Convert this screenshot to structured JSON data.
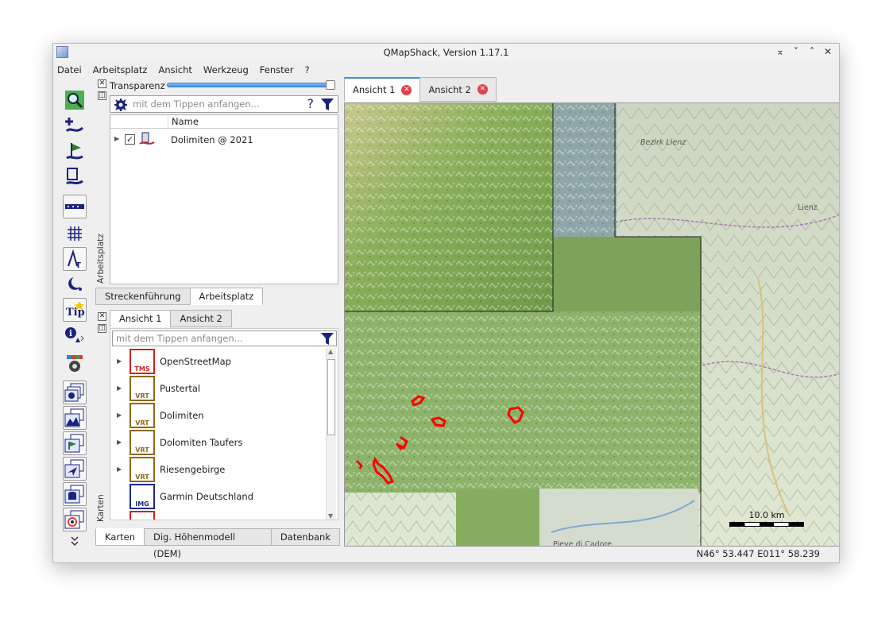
{
  "window": {
    "title": "QMapShack, Version 1.17.1",
    "controls": {
      "restore": "⌅",
      "minimize": "˅",
      "maximize": "˄",
      "close": "✕"
    }
  },
  "menu": [
    "Datei",
    "Arbeitsplatz",
    "Ansicht",
    "Werkzeug",
    "Fenster",
    "?"
  ],
  "toolbar_icons": [
    "search-map-icon",
    "add-waypoint-icon",
    "add-flag-icon",
    "add-route-icon",
    "ruler-icon",
    "grid-icon",
    "text-tool-icon",
    "night-mode-icon",
    "tip-icon",
    "info-icon",
    "settings-icon",
    "map-dock-icon",
    "dem-dock-icon",
    "workspace-dock-icon",
    "routing-dock-icon",
    "database-dock-icon",
    "realtime-dock-icon",
    "more-icon"
  ],
  "workspace": {
    "vertical_label": "Arbeitsplatz",
    "transparency_label": "Transparenz",
    "transparency_value": 1.0,
    "search_placeholder": "mit dem Tippen anfangen...",
    "help_symbol": "?",
    "column_header": "Name",
    "projects": [
      {
        "name": "Dolimiten @ 2021",
        "checked": "✓"
      }
    ],
    "tabs": [
      "Streckenführung",
      "Arbeitsplatz"
    ]
  },
  "maps_panel": {
    "vertical_label": "Karten",
    "view_tabs": [
      "Ansicht 1",
      "Ansicht 2"
    ],
    "search_placeholder": "mit dem Tippen anfangen...",
    "maps": [
      {
        "name": "OpenStreetMap",
        "type": "TMS",
        "color": "#d42020"
      },
      {
        "name": "Pustertal",
        "type": "VRT",
        "color": "#8a6a1a"
      },
      {
        "name": "Dolimiten",
        "type": "VRT",
        "color": "#8a6a1a"
      },
      {
        "name": "Dolomiten Taufers",
        "type": "VRT",
        "color": "#8a6a1a"
      },
      {
        "name": "Riesengebirge",
        "type": "VRT",
        "color": "#8a6a1a"
      },
      {
        "name": "Garmin Deutschland",
        "type": "IMG",
        "color": "#1a2a8a"
      }
    ],
    "bottom_tabs": [
      "Karten",
      "Dig. Höhenmodell (DEM)",
      "Datenbank"
    ]
  },
  "views": {
    "tabs": [
      {
        "label": "Ansicht 1",
        "active": true
      },
      {
        "label": "Ansicht 2",
        "active": false
      }
    ],
    "close_symbol": "✕"
  },
  "map": {
    "place_labels": [
      "Bezirk Lienz",
      "Lienz",
      "Pieve di Cadore"
    ],
    "scale_label": "10.0 km"
  },
  "status": {
    "coordinates": "N46° 53.447 E011° 58.239"
  },
  "colors": {
    "accent": "#3d8ee0",
    "track": "#ff0000",
    "close": "#e0414a"
  }
}
